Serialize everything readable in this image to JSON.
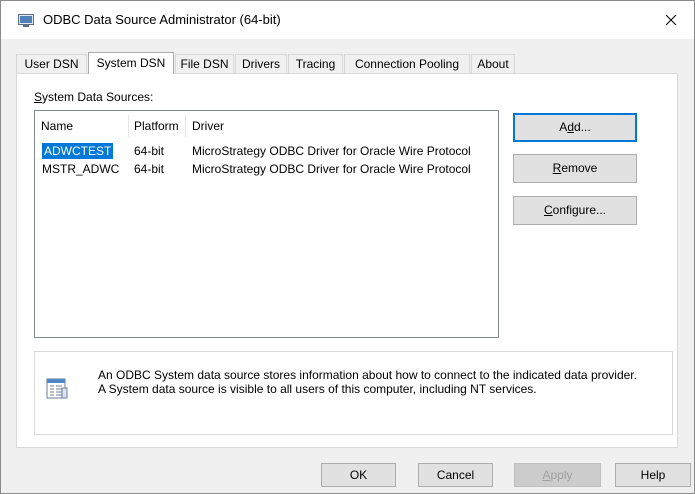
{
  "window": {
    "title": "ODBC Data Source Administrator (64-bit)",
    "close_glyph": "✕"
  },
  "tabs": [
    {
      "label": "User DSN",
      "active": false
    },
    {
      "label": "System DSN",
      "active": true
    },
    {
      "label": "File DSN",
      "active": false
    },
    {
      "label": "Drivers",
      "active": false
    },
    {
      "label": "Tracing",
      "active": false
    },
    {
      "label": "Connection Pooling",
      "active": false
    },
    {
      "label": "About",
      "active": false
    }
  ],
  "system_dsn": {
    "section_label_prefix": "",
    "section_label_accel": "S",
    "section_label_rest": "ystem Data Sources:",
    "columns": [
      "Name",
      "Platform",
      "Driver"
    ],
    "rows": [
      {
        "name": "ADWCTEST",
        "platform": "64-bit",
        "driver": "MicroStrategy ODBC Driver for Oracle Wire Protocol",
        "selected": true
      },
      {
        "name": "MSTR_ADWC",
        "platform": "64-bit",
        "driver": "MicroStrategy ODBC Driver for Oracle Wire Protocol",
        "selected": false
      }
    ],
    "buttons": {
      "add": {
        "accel": "",
        "pre": "A",
        "u": "d",
        "post": "d..."
      },
      "remove": {
        "pre": "",
        "u": "R",
        "post": "emove"
      },
      "configure": {
        "pre": "",
        "u": "C",
        "post": "onfigure..."
      }
    },
    "info_line1": "An ODBC System data source stores information about how to connect to the indicated data provider.",
    "info_line2": "A System data source is visible to all users of this computer, including NT services."
  },
  "footer": {
    "ok": "OK",
    "cancel": "Cancel",
    "apply": "Apply",
    "apply_accel": "A",
    "apply_rest": "pply",
    "help": "Help"
  },
  "colors": {
    "selection": "#0078d7",
    "default_button_border": "#0078d7"
  }
}
